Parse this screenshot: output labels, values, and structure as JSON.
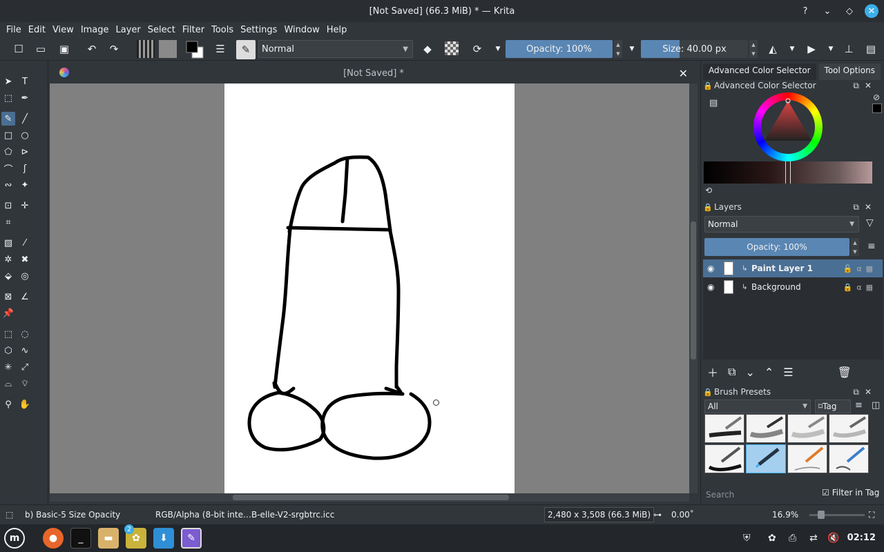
{
  "window": {
    "title": "[Not Saved]  (66.3 MiB)  * — Krita"
  },
  "menu": [
    "File",
    "Edit",
    "View",
    "Image",
    "Layer",
    "Select",
    "Filter",
    "Tools",
    "Settings",
    "Window",
    "Help"
  ],
  "toolbar": {
    "blend_mode": "Normal",
    "opacity": "Opacity: 100%",
    "size": "Size: 40.00 px"
  },
  "document": {
    "tab_title": "[Not Saved]  *"
  },
  "dockers": {
    "tabs": [
      "Advanced Color Selector",
      "Tool Options"
    ],
    "color_selector_title": "Advanced Color Selector",
    "layers_title": "Layers",
    "layers_blend": "Normal",
    "layers_opacity": "Opacity:  100%",
    "layers": [
      {
        "name": "Paint Layer 1",
        "selected": true
      },
      {
        "name": "Background",
        "selected": false
      }
    ],
    "brush_presets_title": "Brush Presets",
    "brush_filter": "All",
    "brush_tag": "Tag",
    "brush_search_placeholder": "Search",
    "filter_in_tag": "Filter in Tag"
  },
  "status": {
    "brush": "b) Basic-5 Size Opacity",
    "color_profile": "RGB/Alpha (8-bit inte…B-elle-V2-srgbtrc.icc",
    "dimensions": "2,480 x 3,508 (66.3 MiB)",
    "rotation": "0.00˚",
    "zoom": "16.9%"
  },
  "taskbar": {
    "badge": "2",
    "clock": "02:12"
  },
  "colors": {
    "accent": "#3daee9",
    "selection": "#4a6f94",
    "slider": "#5a86b3",
    "bg": "#31363b"
  }
}
